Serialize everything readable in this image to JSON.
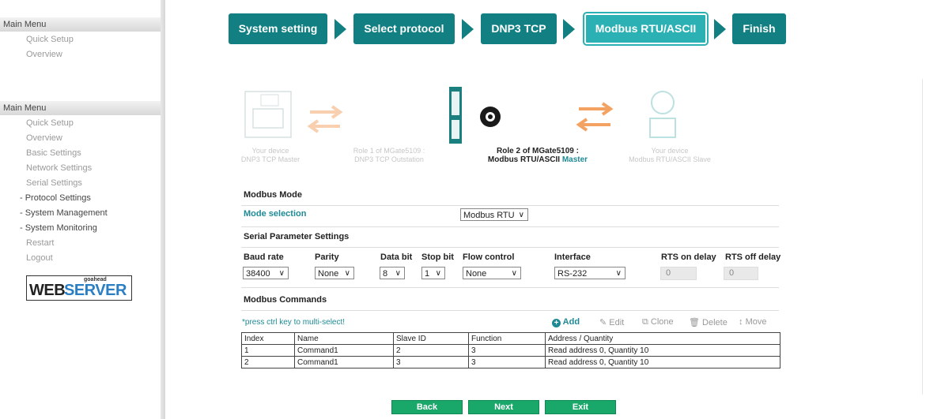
{
  "top_menu": {
    "header": "Main Menu",
    "items": [
      "Quick Setup",
      "Overview"
    ]
  },
  "main_menu": {
    "header": "Main Menu",
    "items": [
      "Quick Setup",
      "Overview",
      "Basic Settings",
      "Network Settings",
      "Serial Settings",
      "- Protocol Settings",
      "- System Management",
      "- System Monitoring",
      "Restart",
      "Logout"
    ]
  },
  "logo": {
    "small": "goahead",
    "web": "WEB",
    "server": "SERVER"
  },
  "wizard": {
    "steps": [
      "System setting",
      "Select protocol",
      "DNP3 TCP",
      "Modbus RTU/ASCII",
      "Finish"
    ],
    "active_index": 3
  },
  "diagram": {
    "device1": [
      "Your device",
      "DNP3 TCP Master"
    ],
    "role1": [
      "Role 1 of MGate5109 :",
      "DNP3 TCP Outstation"
    ],
    "role2_line1": "Role 2 of MGate5109 :",
    "role2_line2a": "Modbus RTU/ASCII",
    "role2_line2b": "Master",
    "device2": [
      "Your device",
      "Modbus RTU/ASCII Slave"
    ]
  },
  "modbus_mode": {
    "title": "Modbus Mode",
    "label": "Mode selection",
    "value": "Modbus RTU"
  },
  "serial": {
    "title": "Serial Parameter Settings",
    "headers": [
      "Baud rate",
      "Parity",
      "Data bit",
      "Stop bit",
      "Flow control",
      "Interface",
      "RTS on delay",
      "RTS off delay"
    ],
    "values": [
      "38400",
      "None",
      "8",
      "1",
      "None",
      "RS-232",
      "0",
      "0"
    ]
  },
  "commands": {
    "title": "Modbus Commands",
    "hint": "*press ctrl key to multi-select!",
    "tools": [
      "Add",
      "Edit",
      "Clone",
      "Delete",
      "Move"
    ],
    "columns": [
      "Index",
      "Name",
      "Slave ID",
      "Function",
      "Address / Quantity"
    ],
    "rows": [
      [
        "1",
        "Command1",
        "2",
        "3",
        "Read address 0, Quantity 10"
      ],
      [
        "2",
        "Command1",
        "3",
        "3",
        "Read address 0, Quantity 10"
      ]
    ]
  },
  "buttons": [
    "Back",
    "Next",
    "Exit"
  ],
  "colors": {
    "step": "#127f82",
    "step_active": "#2bb0b3",
    "button": "#1aa76a",
    "arrow": "#f4c08e"
  }
}
